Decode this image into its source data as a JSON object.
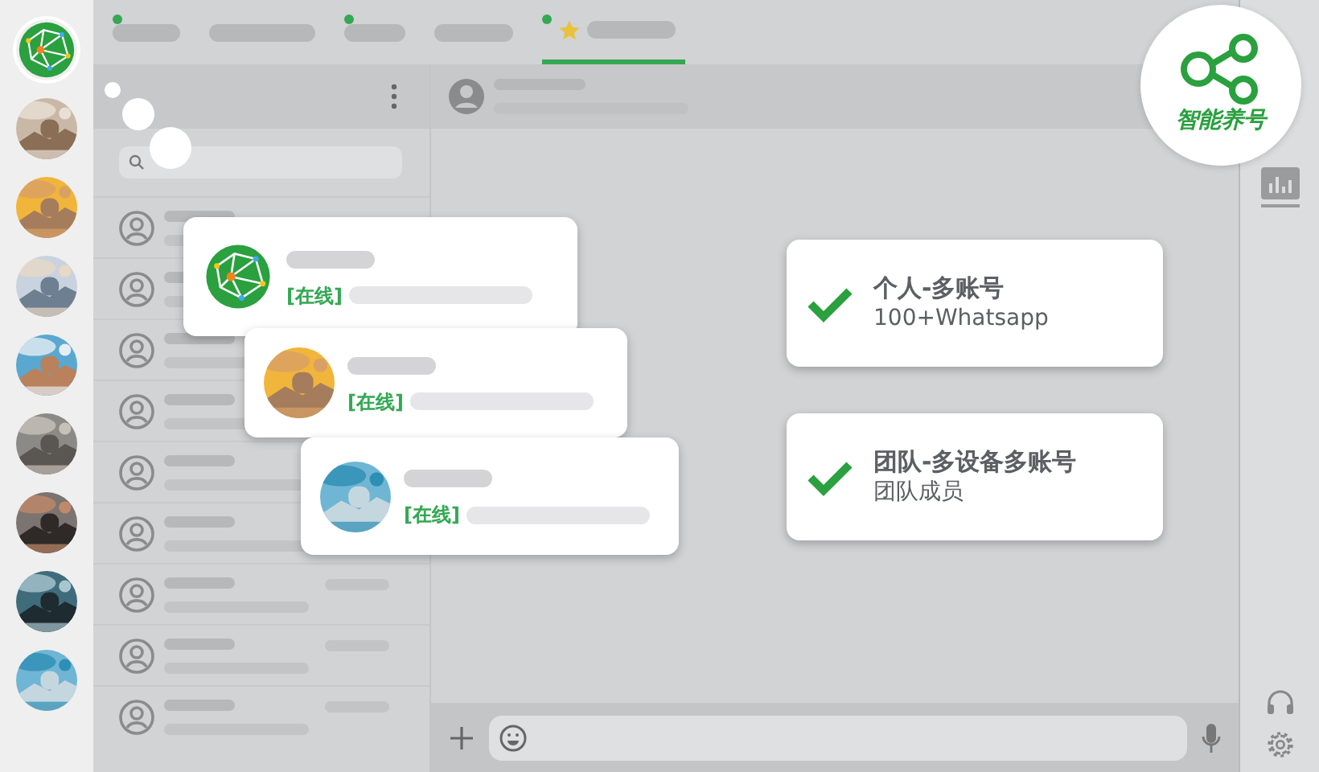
{
  "rail": [
    {
      "kind": "logo",
      "selected": true
    },
    {
      "kind": "picture",
      "selected": false
    },
    {
      "kind": "picture",
      "selected": false
    },
    {
      "kind": "picture",
      "selected": false
    },
    {
      "kind": "picture",
      "selected": false
    },
    {
      "kind": "picture",
      "selected": false
    },
    {
      "kind": "picture",
      "selected": false
    },
    {
      "kind": "picture",
      "selected": false
    },
    {
      "kind": "picture",
      "selected": false
    }
  ],
  "tabs": [
    {
      "online": true,
      "starred": false,
      "selected": false
    },
    {
      "online": false,
      "starred": false,
      "selected": false
    },
    {
      "online": true,
      "starred": false,
      "selected": false
    },
    {
      "online": false,
      "starred": false,
      "selected": false
    },
    {
      "online": true,
      "starred": true,
      "selected": true
    }
  ],
  "badge": {
    "label": "智能养号"
  },
  "account_cards": [
    {
      "kind": "logo",
      "status": "[在线]"
    },
    {
      "kind": "picture",
      "status": "[在线]"
    },
    {
      "kind": "picture",
      "status": "[在线]"
    }
  ],
  "features": [
    {
      "title": "个人-多账号",
      "subtitle": "100+Whatsapp"
    },
    {
      "title": "团队-多设备多账号",
      "subtitle": "团队成员"
    }
  ]
}
